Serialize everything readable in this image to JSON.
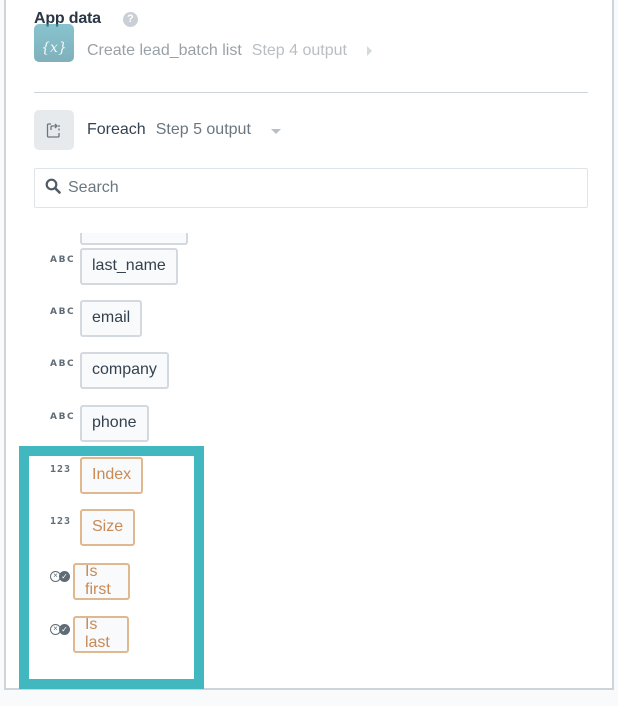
{
  "header": {
    "title": "App data",
    "help_icon": "question-circle-icon"
  },
  "steps": [
    {
      "icon": "variable-icon",
      "icon_text": "{x}",
      "name": "Create lead_batch list",
      "subtitle": "Step 4 output",
      "expander": "caret-right-icon"
    },
    {
      "icon": "loop-icon",
      "name": "Foreach",
      "subtitle": "Step 5 output",
      "expander": "caret-down-icon"
    }
  ],
  "search": {
    "placeholder": "Search",
    "value": ""
  },
  "fields": [
    {
      "type": "ABC",
      "label": "last_name"
    },
    {
      "type": "ABC",
      "label": "email"
    },
    {
      "type": "ABC",
      "label": "company"
    },
    {
      "type": "ABC",
      "label": "phone"
    },
    {
      "type": "123",
      "label": "Index"
    },
    {
      "type": "123",
      "label": "Size"
    },
    {
      "type": "boolean",
      "label": "Is first"
    },
    {
      "type": "boolean",
      "label": "Is last"
    }
  ],
  "highlight_color": "#41b8c0",
  "meta_pill_color": "#c98a55"
}
